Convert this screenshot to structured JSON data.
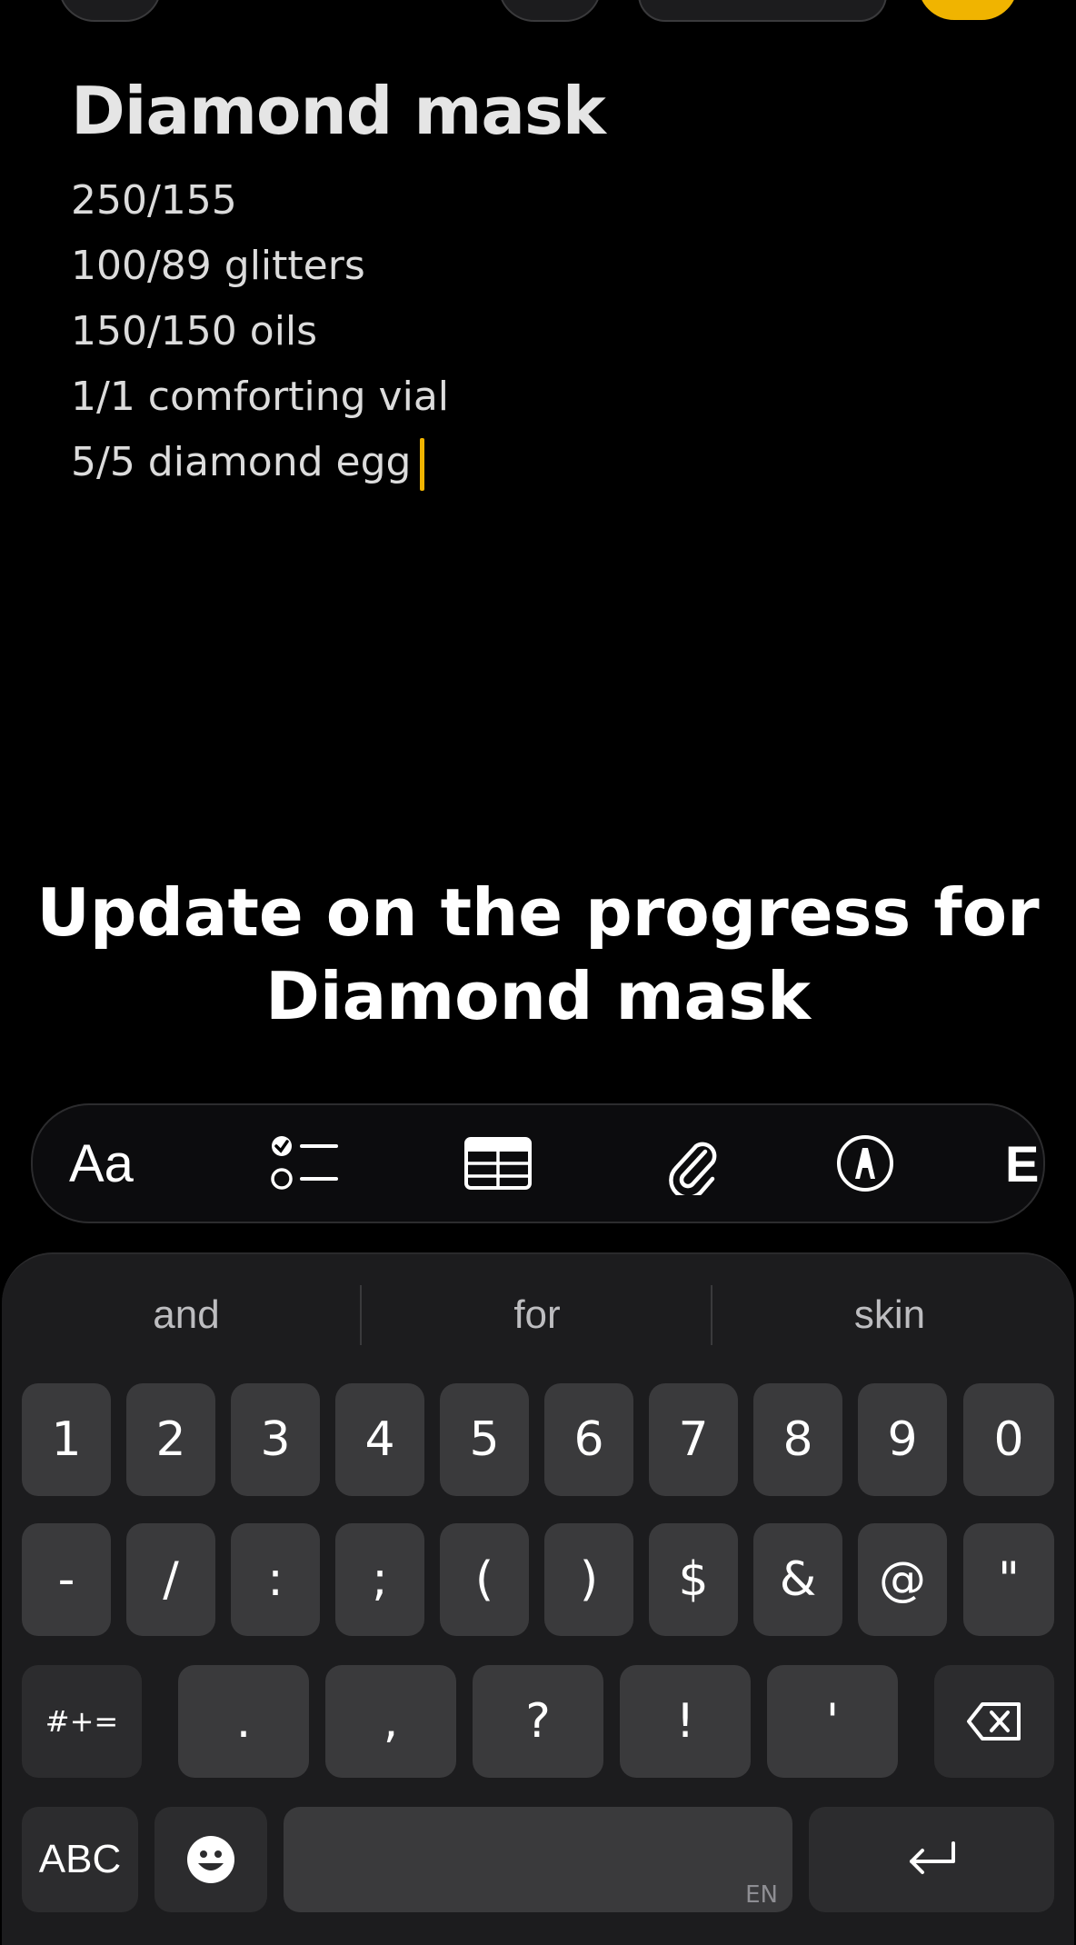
{
  "note": {
    "title": "Diamond mask",
    "lines": [
      "250/155",
      "100/89 glitters",
      "150/150 oils",
      "1/1 comforting vial",
      "5/5 diamond egg"
    ]
  },
  "overlay": {
    "line1": "Update on the progress for",
    "line2": "Diamond mask"
  },
  "format_bar": {
    "text_style_label": "Aa",
    "icons": [
      "checklist-icon",
      "table-icon",
      "paperclip-icon",
      "markup-pen-icon",
      "more-icon"
    ],
    "partial_label": "E"
  },
  "keyboard": {
    "suggestions": [
      "and",
      "for",
      "skin"
    ],
    "row1": [
      "1",
      "2",
      "3",
      "4",
      "5",
      "6",
      "7",
      "8",
      "9",
      "0"
    ],
    "row2": [
      "-",
      "/",
      ":",
      ";",
      "(",
      ")",
      "$",
      "&",
      "@",
      "\""
    ],
    "row3": [
      "#+=",
      ".",
      ",",
      "?",
      "!",
      "'"
    ],
    "abc_label": "ABC",
    "space_lang": "EN"
  },
  "colors": {
    "accent": "#f0b400",
    "background": "#000000",
    "key": "#3a3a3c"
  }
}
